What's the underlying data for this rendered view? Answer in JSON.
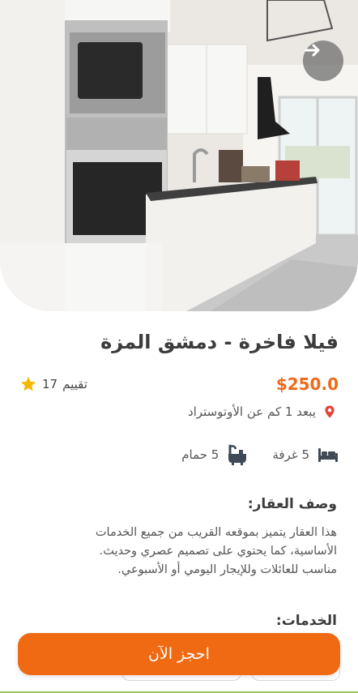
{
  "property": {
    "title": "فيلا فاخرة - دمشق المزة",
    "price": "$250.0",
    "rating_count": "17",
    "rating_label": "تقييم",
    "location": "يبعد 1 كم عن الأوتوستراد",
    "rooms": "5 غرفة",
    "baths": "5 حمام"
  },
  "description": {
    "heading": "وصف العقار:",
    "lines": [
      "هذا العقار يتميز بموقعه القريب من جميع الخدمات",
      "الأساسية، كما يحتوي على تصميم عصري وحديث.",
      "مناسب للعائلات وللإيجار اليومي أو الأسبوعي."
    ]
  },
  "services": {
    "heading": "الخدمات:"
  },
  "actions": {
    "book_label": "احجز الآن"
  },
  "icons": {
    "next": "arrow-right-icon",
    "star": "star-icon",
    "location": "location-pin-icon",
    "bed": "bed-icon",
    "bath": "bathtub-icon"
  },
  "colors": {
    "accent": "#ef6a12",
    "star": "#f5b800",
    "pin": "#e2453c"
  }
}
